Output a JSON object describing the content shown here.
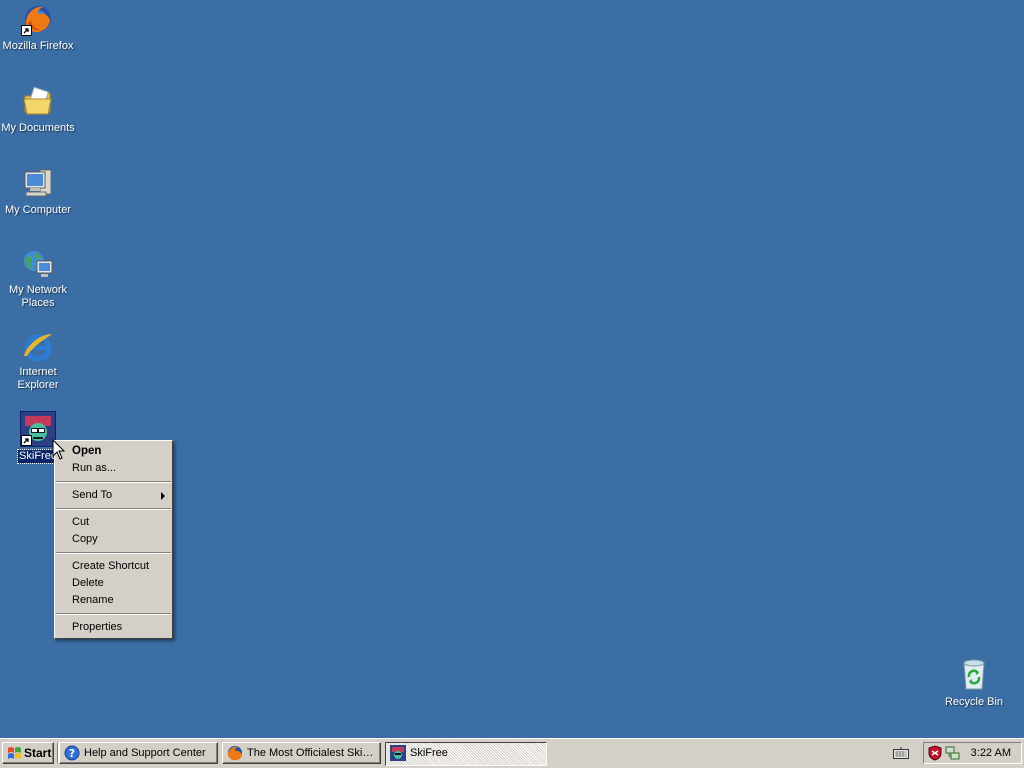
{
  "desktop": {
    "background_color": "#3a6ea5",
    "icons": [
      {
        "label": "Mozilla Firefox",
        "icon": "firefox-icon",
        "shortcut": true
      },
      {
        "label": "My Documents",
        "icon": "my-documents-icon",
        "shortcut": false
      },
      {
        "label": "My Computer",
        "icon": "my-computer-icon",
        "shortcut": false
      },
      {
        "label": "My Network Places",
        "icon": "network-places-icon",
        "shortcut": false
      },
      {
        "label": "Internet Explorer",
        "icon": "internet-explorer-icon",
        "shortcut": false
      },
      {
        "label": "SkiFree",
        "icon": "skifree-icon",
        "shortcut": true,
        "selected": true
      },
      {
        "label": "Recycle Bin",
        "icon": "recycle-bin-icon",
        "shortcut": false
      }
    ]
  },
  "context_menu": {
    "open": "Open",
    "run_as": "Run as...",
    "send_to": "Send To",
    "cut": "Cut",
    "copy": "Copy",
    "create_shortcut": "Create Shortcut",
    "delete": "Delete",
    "rename": "Rename",
    "properties": "Properties"
  },
  "taskbar": {
    "start_label": "Start",
    "tasks": [
      {
        "label": "Help and Support Center",
        "icon": "help-icon"
      },
      {
        "label": "The Most Officialest SkiF...",
        "icon": "firefox-icon"
      },
      {
        "label": "SkiFree",
        "icon": "skifree-icon",
        "active": true
      }
    ],
    "tray": {
      "icons": [
        "shield-icon",
        "network-icon"
      ],
      "clock": "3:22 AM"
    }
  }
}
